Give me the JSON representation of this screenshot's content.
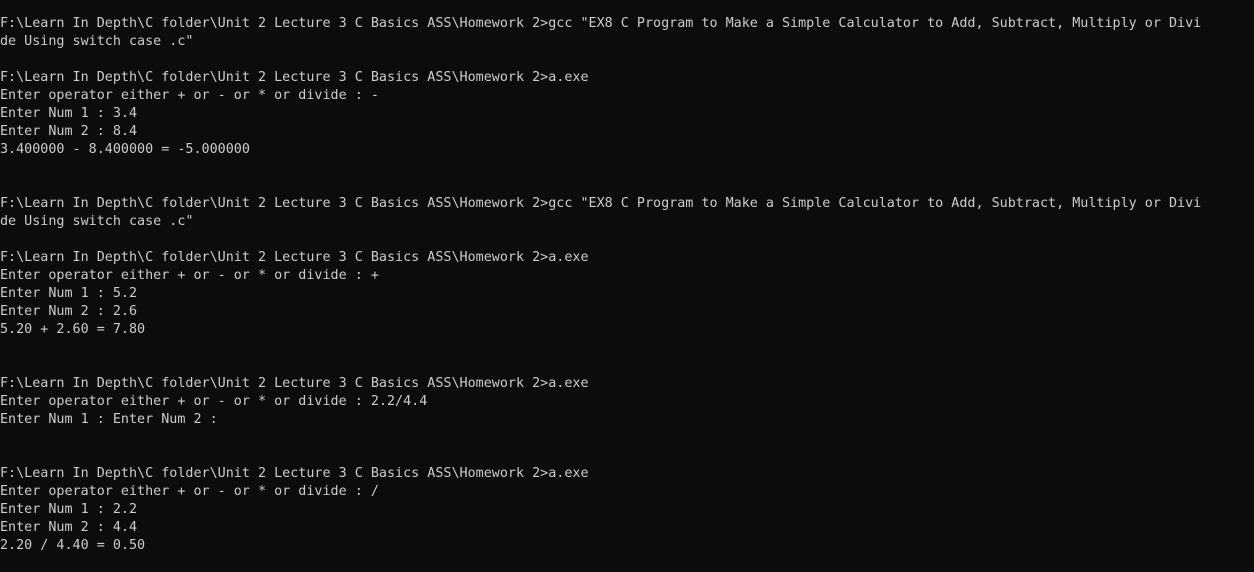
{
  "console": {
    "lines": [
      "F:\\Learn In Depth\\C folder\\Unit 2 Lecture 3 C Basics ASS\\Homework 2>gcc \"EX8 C Program to Make a Simple Calculator to Add, Subtract, Multiply or Divi",
      "de Using switch case .c\"",
      "",
      "F:\\Learn In Depth\\C folder\\Unit 2 Lecture 3 C Basics ASS\\Homework 2>a.exe",
      "Enter operator either + or - or * or divide : -",
      "Enter Num 1 : 3.4",
      "Enter Num 2 : 8.4",
      "3.400000 - 8.400000 = -5.000000",
      "",
      "",
      "F:\\Learn In Depth\\C folder\\Unit 2 Lecture 3 C Basics ASS\\Homework 2>gcc \"EX8 C Program to Make a Simple Calculator to Add, Subtract, Multiply or Divi",
      "de Using switch case .c\"",
      "",
      "F:\\Learn In Depth\\C folder\\Unit 2 Lecture 3 C Basics ASS\\Homework 2>a.exe",
      "Enter operator either + or - or * or divide : +",
      "Enter Num 1 : 5.2",
      "Enter Num 2 : 2.6",
      "5.20 + 2.60 = 7.80",
      "",
      "",
      "F:\\Learn In Depth\\C folder\\Unit 2 Lecture 3 C Basics ASS\\Homework 2>a.exe",
      "Enter operator either + or - or * or divide : 2.2/4.4",
      "Enter Num 1 : Enter Num 2 :",
      "",
      "",
      "F:\\Learn In Depth\\C folder\\Unit 2 Lecture 3 C Basics ASS\\Homework 2>a.exe",
      "Enter operator either + or - or * or divide : /",
      "Enter Num 1 : 2.2",
      "Enter Num 2 : 4.4",
      "2.20 / 4.40 = 0.50"
    ]
  },
  "colors": {
    "background": "#0c0c0c",
    "text": "#cccccc"
  }
}
